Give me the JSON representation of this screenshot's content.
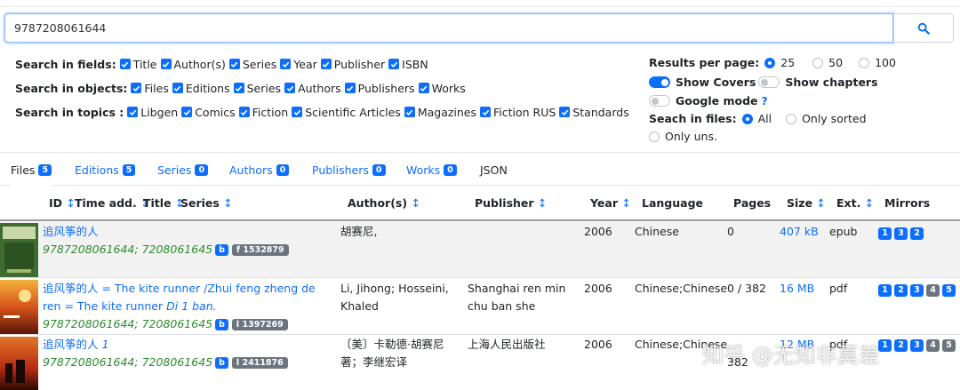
{
  "search": {
    "value": "9787208061644"
  },
  "fields": {
    "label": "Search in fields:",
    "items": [
      "Title",
      "Author(s)",
      "Series",
      "Year",
      "Publisher",
      "ISBN"
    ]
  },
  "objects": {
    "label": "Search in objects:",
    "items": [
      "Files",
      "Editions",
      "Series",
      "Authors",
      "Publishers",
      "Works"
    ]
  },
  "topics": {
    "label": "Search in topics :",
    "items": [
      "Libgen",
      "Comics",
      "Fiction",
      "Scientific Articles",
      "Magazines",
      "Fiction RUS",
      "Standards"
    ]
  },
  "results_per_page": {
    "label": "Results per page:",
    "options": [
      "25",
      "50",
      "100"
    ],
    "selected": "25"
  },
  "toggles": {
    "show_covers": "Show Covers",
    "show_chapters": "Show chapters",
    "google_mode": "Google mode",
    "help": "?"
  },
  "search_in_files": {
    "label": "Seach in files:",
    "all": "All",
    "only_sorted": "Only sorted",
    "only_uns": "Only uns."
  },
  "tabs": [
    {
      "label": "Files",
      "count": "5"
    },
    {
      "label": "Editions",
      "count": "5"
    },
    {
      "label": "Series",
      "count": "0"
    },
    {
      "label": "Authors",
      "count": "0"
    },
    {
      "label": "Publishers",
      "count": "0"
    },
    {
      "label": "Works",
      "count": "0"
    },
    {
      "label": "JSON",
      "count": ""
    }
  ],
  "columns": {
    "id": "ID",
    "time": "Time add.",
    "title": "Title",
    "series": "Series",
    "authors": "Author(s)",
    "publisher": "Publisher",
    "year": "Year",
    "language": "Language",
    "pages": "Pages",
    "size": "Size",
    "ext": "Ext.",
    "mirrors": "Mirrors",
    "sort_arrow": "↕"
  },
  "rows": [
    {
      "title": "追风筝的人",
      "title_italic": "",
      "isbn": "9787208061644; 7208061645",
      "b": "b",
      "fid": "f 1532879",
      "authors": "胡赛尼,",
      "publisher": "",
      "year": "2006",
      "language": "Chinese",
      "pages": "0",
      "size": "407 kB",
      "ext": "epub",
      "mirrors": [
        "1",
        "3",
        "2"
      ]
    },
    {
      "title": "追风筝的人 = The kite runner /Zhui feng zheng de ren = The kite runner",
      "title_italic": "Di 1 ban.",
      "isbn": "9787208061644; 7208061645",
      "b": "b",
      "fid": "l 1397269",
      "authors": "Li, Jihong; Hosseini, Khaled",
      "publisher": "Shanghai ren min chu ban she",
      "year": "2006",
      "language": "Chinese;Chinese",
      "pages": "0 / 382",
      "size": "16 MB",
      "ext": "pdf",
      "mirrors": [
        "1",
        "2",
        "3",
        "4",
        "5"
      ]
    },
    {
      "title": "追风筝的人",
      "title_italic": "1",
      "isbn": "9787208061644; 7208061645",
      "b": "b",
      "fid": "l 2411876",
      "authors": "〔美〕卡勒德·胡赛尼著；李继宏译",
      "publisher": "上海人民出版社",
      "year": "2006",
      "language": "Chinese;Chinese",
      "pages": "382",
      "size": "12 MB",
      "ext": "pdf",
      "mirrors": [
        "1",
        "2",
        "3",
        "4",
        "5"
      ]
    }
  ],
  "watermark": "知乎 @无知非莫差"
}
